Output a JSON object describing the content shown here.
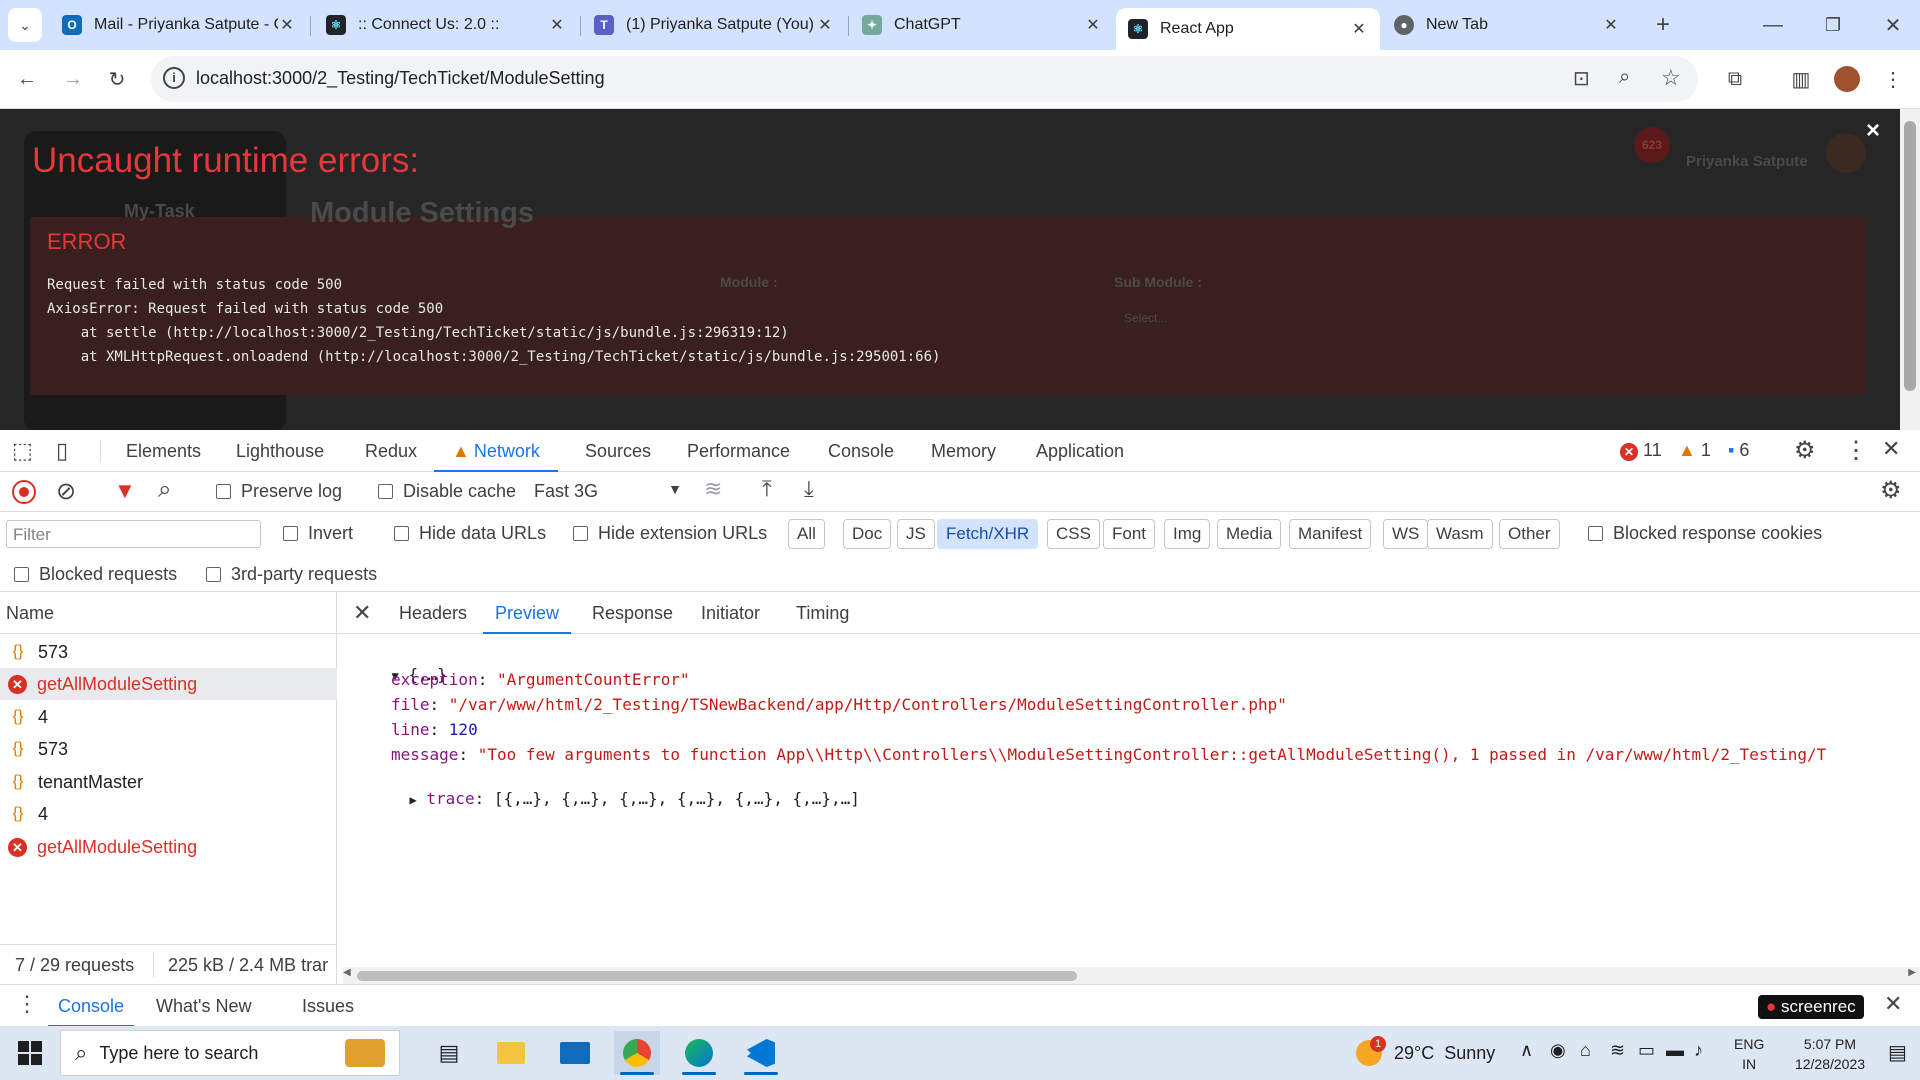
{
  "browser": {
    "tabs": [
      {
        "title": "Mail - Priyanka Satpute - O",
        "icon": "outlook-icon",
        "color": "#0f6cbd"
      },
      {
        "title": ":: Connect Us: 2.0 ::",
        "icon": "react-icon",
        "color": "#20232a"
      },
      {
        "title": "(1) Priyanka Satpute (You) |",
        "icon": "teams-icon",
        "color": "#5b5fc7"
      },
      {
        "title": "ChatGPT",
        "icon": "chatgpt-icon",
        "color": "#74aa9c"
      },
      {
        "title": "React App",
        "icon": "react-icon",
        "color": "#20232a",
        "active": true
      },
      {
        "title": "New Tab",
        "icon": "chrome-icon",
        "color": "#5f6368"
      }
    ],
    "url": "localhost:3000/2_Testing/TechTicket/ModuleSetting"
  },
  "page": {
    "ghost": {
      "sidebar_item": "My-Task",
      "heading": "Module Settings",
      "module_label": "Module :",
      "submodule_label": "Sub Module :",
      "select_placeholder": "Select...",
      "notification_count": "623",
      "username": "Priyanka Satpute"
    },
    "overlay": {
      "title": "Uncaught runtime errors:",
      "label": "ERROR",
      "lines": [
        "Request failed with status code 500",
        "AxiosError: Request failed with status code 500",
        "    at settle (http://localhost:3000/2_Testing/TechTicket/static/js/bundle.js:296319:12)",
        "    at XMLHttpRequest.onloadend (http://localhost:3000/2_Testing/TechTicket/static/js/bundle.js:295001:66)"
      ],
      "close": "×"
    }
  },
  "devtools": {
    "tabs": [
      "Elements",
      "Lighthouse",
      "Redux",
      "Network",
      "Sources",
      "Performance",
      "Console",
      "Memory",
      "Application"
    ],
    "active_tab": "Network",
    "counts": {
      "errors": "11",
      "warnings": "1",
      "messages": "6"
    },
    "toolbar": {
      "preserve_log": "Preserve log",
      "disable_cache": "Disable cache",
      "throttle": "Fast 3G"
    },
    "filter": {
      "placeholder": "Filter",
      "invert": "Invert",
      "hide_data_urls": "Hide data URLs",
      "hide_extension_urls": "Hide extension URLs",
      "types": [
        "All",
        "Doc",
        "JS",
        "Fetch/XHR",
        "CSS",
        "Font",
        "Img",
        "Media",
        "Manifest",
        "WS",
        "Wasm",
        "Other"
      ],
      "active_type": "Fetch/XHR",
      "blocked_response_cookies": "Blocked response cookies",
      "blocked_requests": "Blocked requests",
      "third_party": "3rd-party requests"
    },
    "requests": {
      "column": "Name",
      "items": [
        {
          "name": "573",
          "error": false
        },
        {
          "name": "getAllModuleSetting",
          "error": true,
          "selected": true
        },
        {
          "name": "4",
          "error": false
        },
        {
          "name": "573",
          "error": false
        },
        {
          "name": "tenantMaster",
          "error": false
        },
        {
          "name": "4",
          "error": false
        },
        {
          "name": "getAllModuleSetting",
          "error": true
        }
      ],
      "summary_count": "7 / 29 requests",
      "summary_size": "225 kB / 2.4 MB trar"
    },
    "detail": {
      "tabs": [
        "Headers",
        "Preview",
        "Response",
        "Initiator",
        "Timing"
      ],
      "active_tab": "Preview",
      "root": "{,…}",
      "fields": [
        {
          "key": "exception",
          "value": "\"ArgumentCountError\"",
          "kind": "s"
        },
        {
          "key": "file",
          "value": "\"/var/www/html/2_Testing/TSNewBackend/app/Http/Controllers/ModuleSettingController.php\"",
          "kind": "s"
        },
        {
          "key": "line",
          "value": "120",
          "kind": "n"
        },
        {
          "key": "message",
          "value": "\"Too few arguments to function App\\\\Http\\\\Controllers\\\\ModuleSettingController::getAllModuleSetting(), 1 passed in /var/www/html/2_Testing/T",
          "kind": "s"
        }
      ],
      "trace_key": "trace",
      "trace_value": "[{,…}, {,…}, {,…}, {,…}, {,…}, {,…},…]"
    },
    "drawer": {
      "tabs": [
        "Console",
        "What's New",
        "Issues"
      ],
      "active": "Console",
      "badge": "screenrec"
    }
  },
  "taskbar": {
    "search_placeholder": "Type here to search",
    "weather": "29°C  Sunny",
    "weather_badge": "1",
    "lang": "ENG",
    "region": "IN",
    "time": "5:07 PM",
    "date": "12/28/2023"
  }
}
